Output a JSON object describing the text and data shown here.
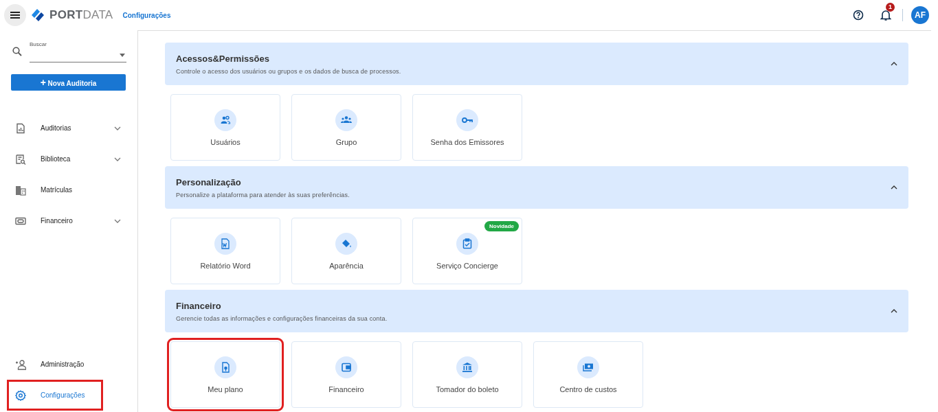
{
  "header": {
    "brand_strong": "PORT",
    "brand_light": "DATA",
    "breadcrumb": "Configurações",
    "notification_count": "1",
    "avatar": "AF"
  },
  "sidebar": {
    "search": {
      "label": "Buscar"
    },
    "new_button": {
      "icon": "+",
      "label": "Nova Auditoria"
    },
    "items": [
      {
        "label": "Auditorias",
        "expandable": true,
        "selected": false,
        "highlighted": false
      },
      {
        "label": "Biblioteca",
        "expandable": true,
        "selected": false,
        "highlighted": false
      },
      {
        "label": "Matrículas",
        "expandable": false,
        "selected": false,
        "highlighted": false
      },
      {
        "label": "Financeiro",
        "expandable": true,
        "selected": false,
        "highlighted": false
      }
    ],
    "bottom_items": [
      {
        "label": "Administração",
        "selected": false,
        "highlighted": false
      },
      {
        "label": "Configurações",
        "selected": true,
        "highlighted": true
      }
    ]
  },
  "sections": [
    {
      "title": "Acessos&Permissões",
      "description": "Controle o acesso dos usuários ou grupos e os dados de busca de processos.",
      "expanded": true,
      "cards": [
        {
          "label": "Usuários",
          "highlighted": false
        },
        {
          "label": "Grupo",
          "highlighted": false
        },
        {
          "label": "Senha dos Emissores",
          "highlighted": false
        }
      ]
    },
    {
      "title": "Personalização",
      "description": "Personalize a plataforma para atender às suas preferências.",
      "expanded": true,
      "cards": [
        {
          "label": "Relatório Word",
          "highlighted": false
        },
        {
          "label": "Aparência",
          "highlighted": false
        },
        {
          "label": "Serviço Concierge",
          "badge": "Novidade",
          "highlighted": false
        }
      ]
    },
    {
      "title": "Financeiro",
      "description": "Gerencie todas as informações e configurações financeiras da sua conta.",
      "expanded": true,
      "cards": [
        {
          "label": "Meu plano",
          "highlighted": true
        },
        {
          "label": "Financeiro",
          "highlighted": false
        },
        {
          "label": "Tomador do boleto",
          "highlighted": false
        },
        {
          "label": "Centro de custos",
          "highlighted": false
        }
      ]
    }
  ]
}
